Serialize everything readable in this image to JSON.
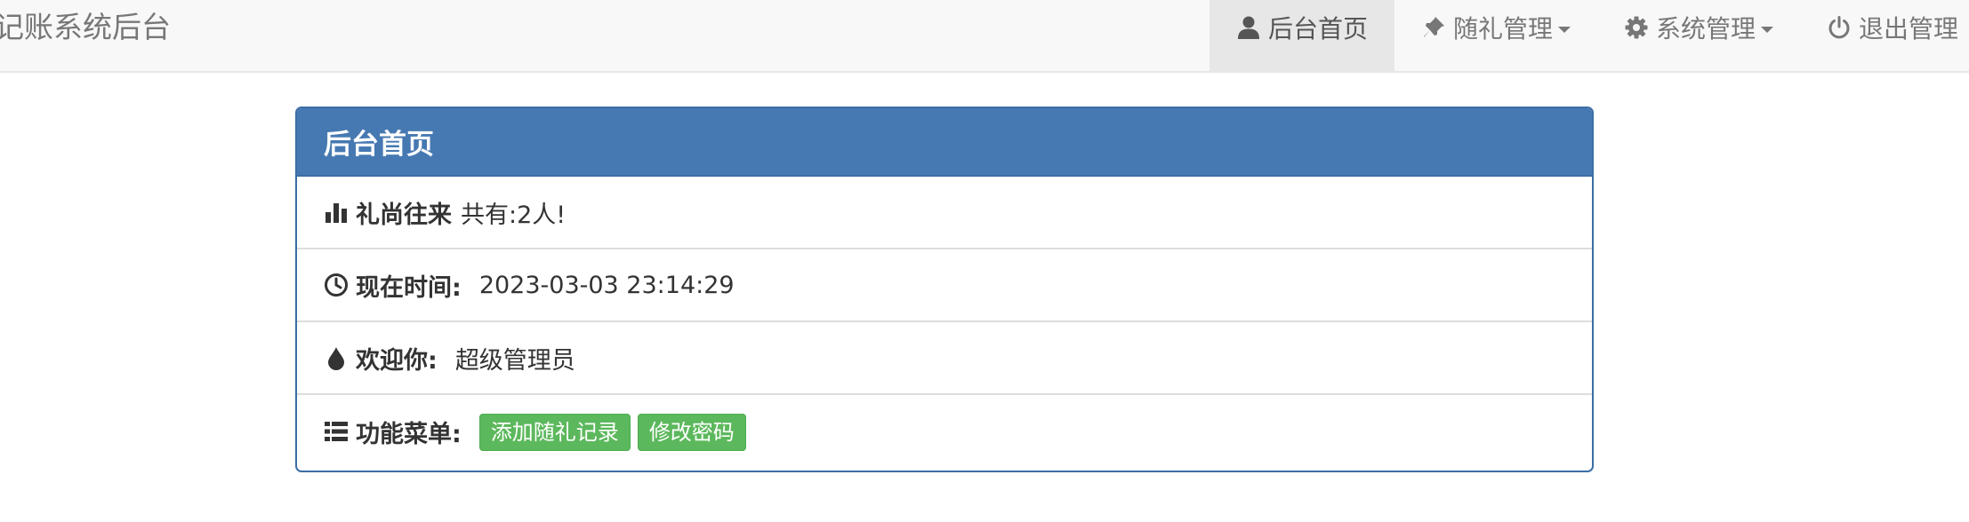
{
  "navbar": {
    "brand": "记账系统后台",
    "items": [
      {
        "label": "后台首页",
        "icon": "user-icon",
        "active": true,
        "dropdown": false
      },
      {
        "label": "随礼管理",
        "icon": "pushpin-icon",
        "active": false,
        "dropdown": true
      },
      {
        "label": "系统管理",
        "icon": "gear-icon",
        "active": false,
        "dropdown": true
      },
      {
        "label": "退出管理",
        "icon": "power-icon",
        "active": false,
        "dropdown": false
      }
    ]
  },
  "panel": {
    "title": "后台首页",
    "rows": [
      {
        "icon": "bar-chart-icon",
        "label": "礼尚往来",
        "value": "共有:2人!"
      },
      {
        "icon": "clock-icon",
        "label": "现在时间:",
        "value": "2023-03-03 23:14:29"
      },
      {
        "icon": "tint-icon",
        "label": "欢迎你:",
        "value": "超级管理员"
      },
      {
        "icon": "list-icon",
        "label": "功能菜单:",
        "buttons": [
          "添加随礼记录",
          "修改密码"
        ]
      }
    ]
  },
  "colors": {
    "navbar_bg": "#f8f8f8",
    "nav_active_bg": "#e7e7e7",
    "panel_header_bg": "#4679b2",
    "panel_border": "#3b6ea5",
    "button_success": "#5cb85c"
  }
}
